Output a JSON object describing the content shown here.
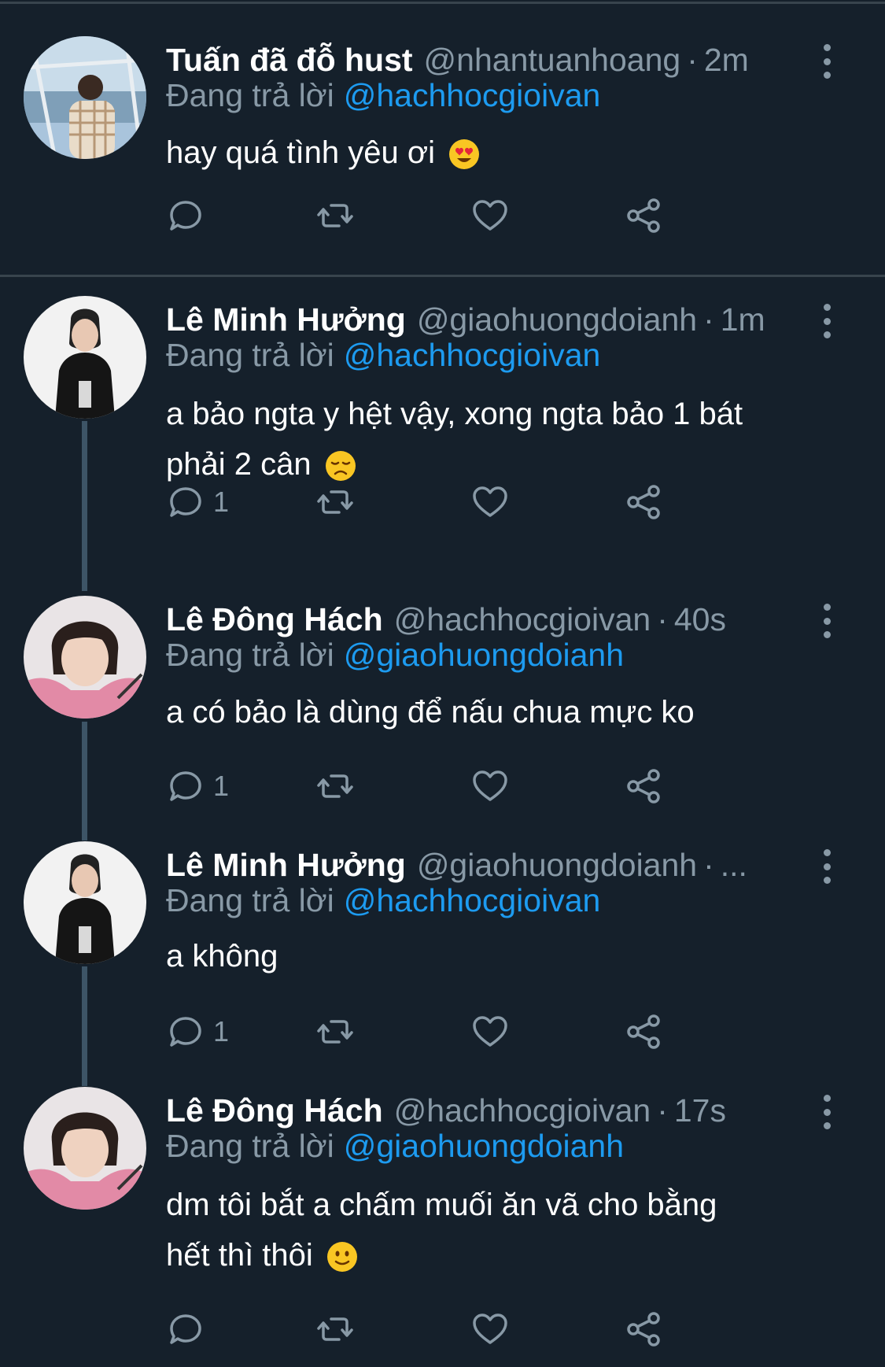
{
  "tweets": [
    {
      "name": "Tuấn đã đỗ hust",
      "handle": "@nhantuanhoang",
      "dot": "·",
      "time": "2m",
      "reply_label": "Đang trả lời",
      "reply_to": "@hachhocgioivan",
      "text_lines": [
        "hay quá tình yêu ơi"
      ],
      "emoji": "heart-eyes",
      "reply_count": "",
      "avatar": "avatar-boat-photo"
    },
    {
      "name": "Lê Minh Hưởng",
      "handle": "@giaohuongdoianh",
      "dot": "·",
      "time": "1m",
      "reply_label": "Đang trả lời",
      "reply_to": "@hachhocgioivan",
      "text_lines": [
        "a bảo ngta y hệt vậy, xong ngta bảo 1 bát",
        "phải 2 cân"
      ],
      "emoji": "disappointed",
      "reply_count": "1",
      "avatar": "avatar-black-hoodie"
    },
    {
      "name": "Lê Đông Hách",
      "handle": "@hachhocgioivan",
      "dot": "·",
      "time": "40s",
      "reply_label": "Đang trả lời",
      "reply_to": "@giaohuongdoianh",
      "text_lines": [
        "a có bảo là dùng để nấu chua mực ko"
      ],
      "emoji": "",
      "reply_count": "1",
      "avatar": "avatar-pink-hoodie"
    },
    {
      "name": "Lê Minh Hưởng",
      "handle": "@giaohuongdoianh",
      "dot": "·",
      "time": "...",
      "reply_label": "Đang trả lời",
      "reply_to": "@hachhocgioivan",
      "text_lines": [
        "a không"
      ],
      "emoji": "",
      "reply_count": "1",
      "avatar": "avatar-black-hoodie"
    },
    {
      "name": "Lê Đông Hách",
      "handle": "@hachhocgioivan",
      "dot": "·",
      "time": "17s",
      "reply_label": "Đang trả lời",
      "reply_to": "@giaohuongdoianh",
      "text_lines": [
        "dm tôi bắt a chấm muối ăn vã cho bằng",
        "hết thì thôi"
      ],
      "emoji": "slight-smile",
      "reply_count": "",
      "avatar": "avatar-pink-hoodie"
    }
  ],
  "icons": {
    "reply": "reply-icon",
    "retweet": "retweet-icon",
    "like": "heart-icon",
    "share": "share-icon",
    "more": "more-icon"
  },
  "colors": {
    "background": "#15202b",
    "divider": "#38444d",
    "secondary_text": "#8899a6",
    "link": "#1d9bf0",
    "thread_line": "#3d5466"
  }
}
